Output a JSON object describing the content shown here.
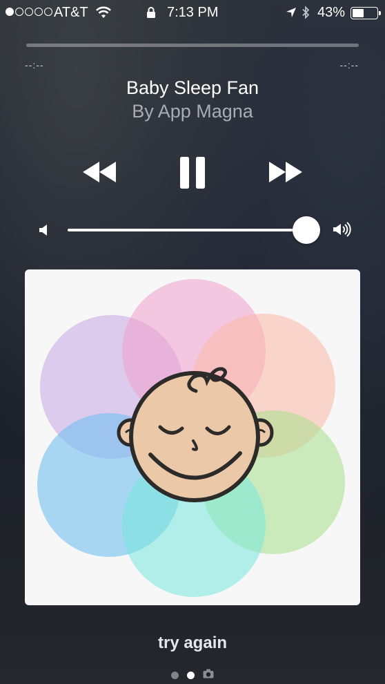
{
  "status_bar": {
    "carrier": "AT&T",
    "time": "7:13 PM",
    "battery_percent": "43%",
    "battery_level": 0.43,
    "signal_bars_filled": 1,
    "signal_bars_total": 5
  },
  "now_playing": {
    "elapsed": "--:--",
    "remaining": "--:--",
    "title": "Baby Sleep Fan",
    "artist": "By App Magna",
    "volume_level": 0.94,
    "state": "playing"
  },
  "bottom": {
    "action_label": "try again"
  },
  "pager": {
    "pages": 3,
    "active_index": 1
  }
}
